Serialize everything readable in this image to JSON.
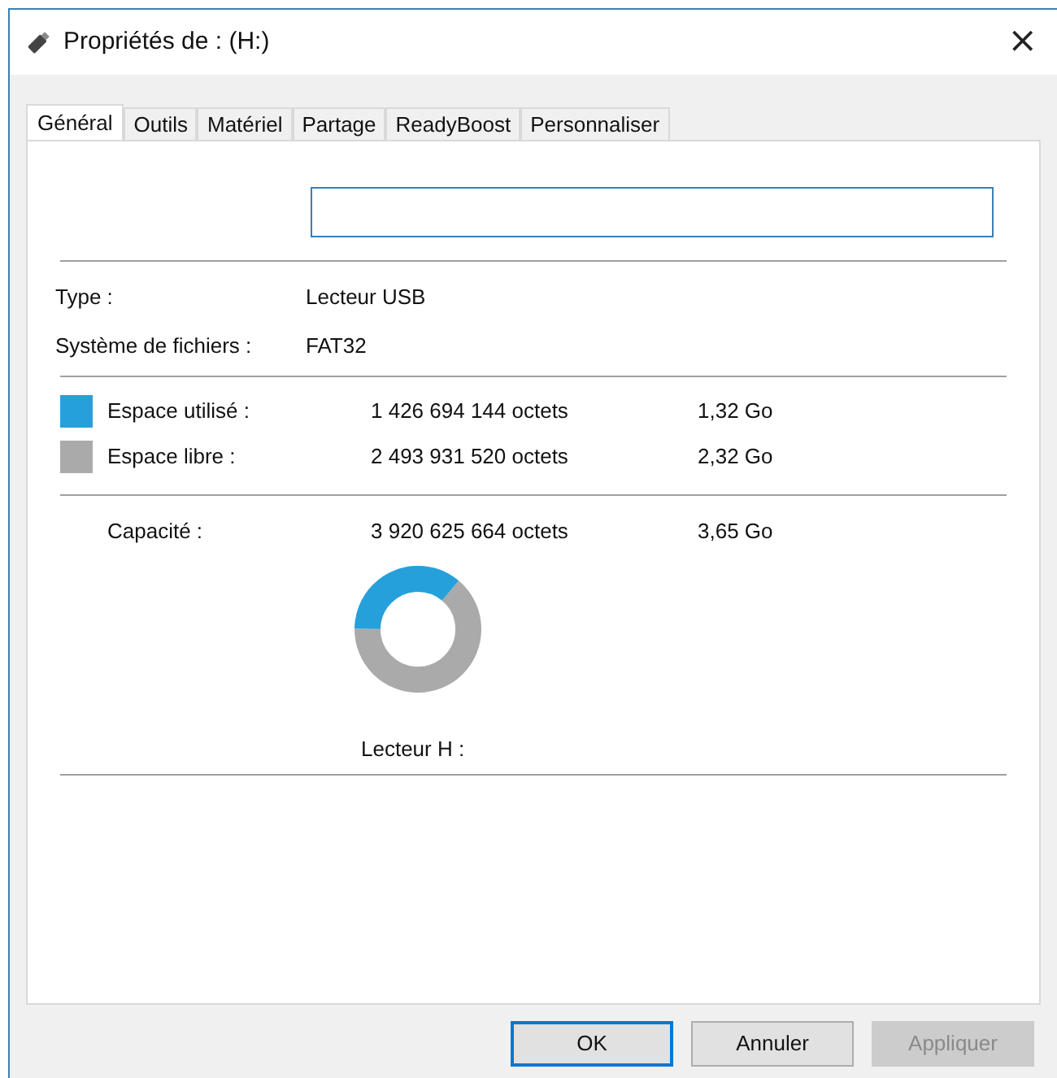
{
  "window": {
    "title": "Propriétés de : (H:)",
    "close": "×"
  },
  "tabs": [
    {
      "label": "Général",
      "selected": true
    },
    {
      "label": "Outils",
      "selected": false
    },
    {
      "label": "Matériel",
      "selected": false
    },
    {
      "label": "Partage",
      "selected": false
    },
    {
      "label": "ReadyBoost",
      "selected": false
    },
    {
      "label": "Personnaliser",
      "selected": false
    }
  ],
  "info": [
    {
      "label": "Type :",
      "value": "Lecteur USB"
    },
    {
      "label": "Système de fichiers :",
      "value": "FAT32"
    }
  ],
  "spaces": [
    {
      "label": "Espace utilisé :",
      "bytes": "1 426 694 144 octets",
      "size": "1,32 Go",
      "color": "#26a0da"
    },
    {
      "label": "Espace libre :",
      "bytes": "2 493 931 520 octets",
      "size": "2,32 Go",
      "color": "#aaaaaa"
    }
  ],
  "capacity": {
    "label": "Capacité :",
    "bytes": "3 920 625 664 octets",
    "size": "3,65 Go"
  },
  "usage": {
    "level": 0.36,
    "caption": "Lecteur H :"
  },
  "buttons": [
    {
      "label": "OK",
      "default": true,
      "disabled": false
    },
    {
      "label": "Annuler",
      "default": false,
      "disabled": false
    },
    {
      "label": "Appliquer",
      "default": false,
      "disabled": true
    }
  ]
}
